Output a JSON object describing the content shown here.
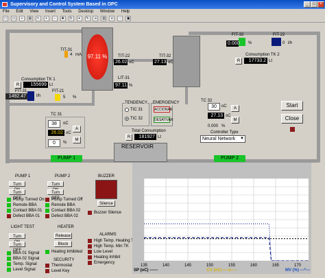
{
  "window": {
    "title": "Supervisory and Control System Based in OPC"
  },
  "menu": [
    "File",
    "Edit",
    "View",
    "Insert",
    "Tools",
    "Desktop",
    "Window",
    "Help"
  ],
  "toolbar": [
    "new-icon",
    "open-icon",
    "save-icon",
    "print-icon",
    "pointer-icon",
    "zoom-in-icon",
    "zoom-out-icon",
    "pan-icon",
    "rotate-icon",
    "datacursor-icon",
    "brush-icon",
    "link-icon",
    "colorbar-icon",
    "legend-icon",
    "hide-icon",
    "show-icon"
  ],
  "process": {
    "tit31": {
      "label": "TIT-31",
      "value": "4",
      "unit": "mA"
    },
    "tank_level": "97.11 %",
    "fit31": {
      "label": "FIT-31",
      "value": "1492.47",
      "unit": "l/h"
    },
    "consumption_tk1": {
      "label": "Consumption TK 1",
      "button": "R",
      "value": "155699",
      "unit": "Lt"
    },
    "fit21": {
      "label": "FIT-21",
      "value": "5",
      "unit": "%"
    },
    "tc31": {
      "label": "TC 31",
      "sp": "38",
      "sp_unit": "oC",
      "sp_btn": "A",
      "pv": "26.02",
      "pv_unit": "oC",
      "out": "0",
      "out_unit": "%",
      "mode_btn": "M"
    },
    "tit22": {
      "label": "TIT-22",
      "value": "26.02",
      "unit": "oC"
    },
    "tit32": {
      "label": "TIT-32",
      "value": "27.13",
      "unit": "oC"
    },
    "lit31": {
      "label": "LIT-31",
      "value": "97.11",
      "unit": "%"
    },
    "tendency": {
      "title": "TENDENCY",
      "options": [
        "TIC 31",
        "TIC 32"
      ],
      "selected": 1
    },
    "emergency": {
      "title": "EMERGENCY",
      "activate": "ACCIONAR",
      "deactivate": "DESATIVAR"
    },
    "total_consumption": {
      "label": "Total Consumption",
      "button": "R",
      "value": "181927",
      "unit": "Lt"
    },
    "reservoir": "RESERVOIR",
    "pump1": "PUMP 1",
    "pump2": "PUMP 2",
    "fit32": {
      "label": "FIT-32",
      "value": "0.000",
      "unit": "%"
    },
    "fit22": {
      "label": "FIT-22",
      "value": "0",
      "unit": "l/h"
    },
    "consumption_tk2": {
      "label": "Consumption TK 2",
      "button": "R",
      "value": "17733.2",
      "unit": "Lt"
    },
    "tc32": {
      "label": "TC 32",
      "sp": "30",
      "sp_unit": "oC",
      "sp_btn": "A",
      "pv": "27.13",
      "pv_unit": "oC",
      "out": "0.000",
      "out_unit": "%",
      "mode_btn": "M"
    },
    "controller": {
      "label": "Controller Type",
      "value": "Neural Network"
    },
    "start": "Start",
    "close": "Close"
  },
  "panel": {
    "pump1": {
      "title": "PUMP 1",
      "on": "Turn ON",
      "off": "Turn OFF",
      "leds": [
        "Pump Turned On",
        "Remote BBA",
        "Contact BBA 01",
        "Defect BBA 01"
      ]
    },
    "pump2": {
      "title": "PUMP 2",
      "on": "Turn ON",
      "off": "Turn OFF",
      "leds": [
        "Pump Turned Off",
        "Remote BBA",
        "Contact BBA 02",
        "Defect BBA 02"
      ]
    },
    "buzzer": {
      "title": "BUZZER",
      "silence": "Silence",
      "led": "Buzzer Silence"
    },
    "light_test": {
      "title": "LIGHT TEST",
      "on": "Turn ON",
      "off": "Turn OFF",
      "leds": [
        "BBA 01 Signal",
        "BBA 02 Signal",
        "Temp. Signal",
        "Level Signal"
      ]
    },
    "heater": {
      "title": "HEATER",
      "release": "Release",
      "block": "Block",
      "led": "Heating Inhibited"
    },
    "security": {
      "title": "SECURITY",
      "leds": [
        "Thermostat",
        "Level Key"
      ]
    },
    "alarms": {
      "title": "ALARMS",
      "leds": [
        "High Temp. Heating TK",
        "High Temp. Min TK",
        "Low Level",
        "Heating Inhibit",
        "Emergency"
      ]
    }
  },
  "chart_data": {
    "type": "line",
    "xlim": [
      135,
      172.5
    ],
    "ylim": [
      0,
      100
    ],
    "x_ticks": [
      "135",
      "140",
      "145",
      "150",
      "155",
      "160",
      "165",
      "170"
    ],
    "grid": true,
    "legend": [
      "SP (oC) ------",
      "CV (oC) ----o----",
      "MV (%) ---*---"
    ],
    "series": [
      {
        "name": "SP (oC)",
        "points": [
          [
            135,
            27
          ],
          [
            163.5,
            27
          ],
          [
            164,
            27
          ],
          [
            172.5,
            27
          ]
        ],
        "color": "#222222",
        "dash": "2,2"
      },
      {
        "name": "CV (oC)",
        "points": [
          [
            135,
            28
          ],
          [
            163.5,
            28
          ],
          [
            164,
            0
          ],
          [
            172.5,
            0
          ]
        ],
        "color": "#1a2a8a",
        "dash": "4,3"
      },
      {
        "name": "MV (%)",
        "points": [
          [
            135,
            45
          ],
          [
            163.5,
            45
          ],
          [
            164,
            0
          ],
          [
            172.5,
            0
          ]
        ],
        "color": "#1a2a8a",
        "dash": "1,2"
      }
    ],
    "colors": {
      "legend_sp": "#000000",
      "legend_cv": "#d8b000",
      "legend_mv": "#1a4fc0"
    }
  }
}
